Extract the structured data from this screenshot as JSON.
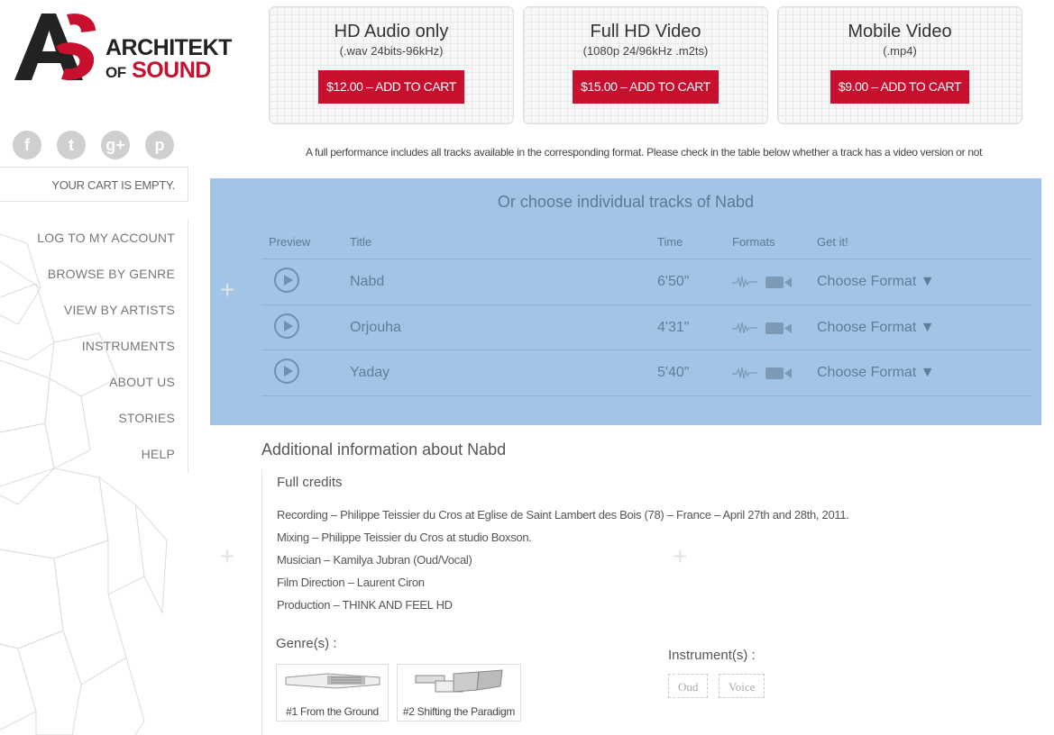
{
  "logo": {
    "monogram": "AS",
    "line1": "ARCHITEKT",
    "line2_small": "OF",
    "line2": "SOUND"
  },
  "social": [
    "f",
    "t",
    "g+",
    "p"
  ],
  "cart": {
    "text": "YOUR CART IS EMPTY."
  },
  "nav": [
    "LOG TO MY ACCOUNT",
    "BROWSE BY GENRE",
    "VIEW BY ARTISTS",
    "INSTRUMENTS",
    "ABOUT US",
    "STORIES",
    "HELP"
  ],
  "products": [
    {
      "title": "HD Audio only",
      "sub": "(.wav 24bits-96kHz)",
      "button": "$12.00 – ADD TO CART"
    },
    {
      "title": "Full HD Video",
      "sub": "(1080p 24/96kHz .m2ts)",
      "button": "$15.00 – ADD TO CART"
    },
    {
      "title": "Mobile Video",
      "sub": "(.mp4)",
      "button": "$9.00 – ADD TO CART"
    }
  ],
  "note": "A full performance includes all tracks available in the corresponding format. Please check in the table below whether a track has a video version or not",
  "tracks": {
    "heading": "Or choose individual tracks of Nabd",
    "headers": {
      "preview": "Preview",
      "title": "Title",
      "time": "Time",
      "formats": "Formats",
      "get": "Get it!"
    },
    "rows": [
      {
        "title": "Nabd",
        "time": "6'50\"",
        "choose": "Choose Format ▼"
      },
      {
        "title": "Orjouha",
        "time": "4'31\"",
        "choose": "Choose Format ▼"
      },
      {
        "title": "Yaday",
        "time": "5'40\"",
        "choose": "Choose Format ▼"
      }
    ]
  },
  "info": {
    "heading": "Additional information about Nabd",
    "credits_heading": "Full credits",
    "credits": [
      "Recording – Philippe Teissier du Cros at Eglise de Saint Lambert des Bois (78) – France – April 27th and 28th, 2011.",
      "Mixing – Philippe Teissier du Cros at studio Boxson.",
      "Musician – Kamilya Jubran (Oud/Vocal)",
      "Film Direction – Laurent Ciron",
      "Production – THINK AND FEEL HD"
    ],
    "genres_heading": "Genre(s) :",
    "genres": [
      "#1 From the Ground",
      "#2 Shifting the Paradigm"
    ],
    "instruments_heading": "Instrument(s) :",
    "instruments": [
      "Oud",
      "Voice"
    ]
  },
  "colors": {
    "brand_red": "#c8102e",
    "panel_blue": "#a2c4e6",
    "panel_text": "#5d7a94"
  }
}
